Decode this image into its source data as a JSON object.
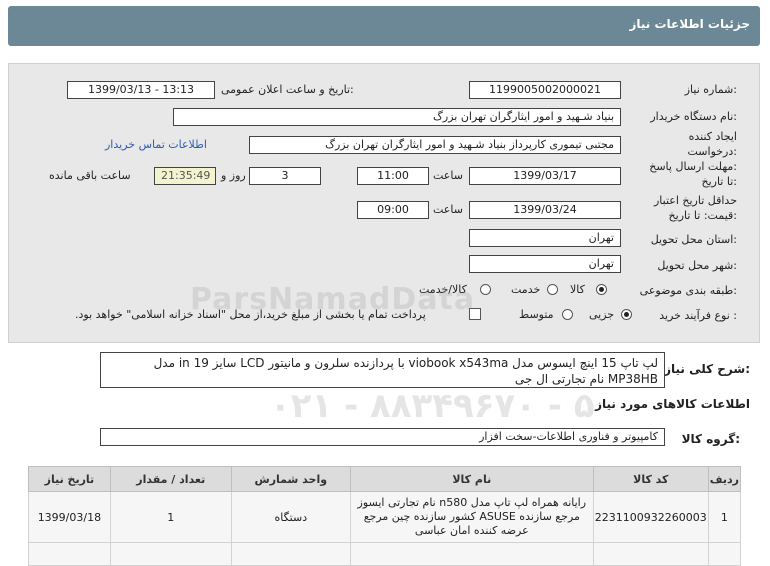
{
  "header": {
    "title": "جزئیات اطلاعات نیاز"
  },
  "fields": {
    "need_number_label": "شماره نیاز:",
    "need_number": "1199005002000021",
    "announce_label": "تاریخ و ساعت اعلان عمومی:",
    "announce_value": "1399/03/13 - 13:13",
    "buyer_label": "نام دستگاه خریدار:",
    "buyer_value": "بنیاد شـهید و امور ایثارگران تهران بزرگ",
    "creator_label_1": "ایجاد کننده",
    "creator_label_2": "درخواست:",
    "creator_value": "مجتبی  تیموری کارپرداز بنیاد شـهید و امور ایثارگران تهران بزرگ",
    "contact_link": "اطلاعات تماس خریدار",
    "deadline_label_1": "مهلت ارسال پاسخ:",
    "deadline_label_2": "تا تاریخ:",
    "deadline_date": "1399/03/17",
    "time_label": "ساعت",
    "deadline_time": "11:00",
    "days_value": "3",
    "days_label": "روز و",
    "remaining_value": "21:35:49",
    "remaining_label": "ساعت باقی مانده",
    "validity_label_1": "حداقل تاریخ اعتبار",
    "validity_label_2": "قیمت: تا تاریخ:",
    "validity_date": "1399/03/24",
    "validity_time_label": "ساعت",
    "validity_time": "09:00",
    "province_label": "استان محل تحویل:",
    "province_value": "تهران",
    "city_label": "شهر محل تحویل:",
    "city_value": "تهران",
    "category_label": "طبقه بندی موضوعی:",
    "category_options": [
      "کالا",
      "خدمت",
      "کالا/خدمت"
    ],
    "process_label": "نوع فرآیند خرید :",
    "process_options": [
      "جزیی",
      "متوسط"
    ],
    "payment_note": "پرداخت تمام یا بخشی از مبلغ خرید،از محل \"اسناد خزانه اسلامی\" خواهد بود."
  },
  "description": {
    "label": "شرح کلی نیاز:",
    "text": "لپ تاپ 15 اینچ ایسوس مدل viobook x543ma با پردازنده سلرون و مانیتور LCD سایز 19 in مدل MP38HB نام تجارتی ال جی"
  },
  "goods": {
    "section_title": "اطلاعات کالاهای مورد نیاز",
    "group_label": "گروه کالا:",
    "group_value": "کامپیوتر و فناوری اطلاعات-سخت افزار"
  },
  "table": {
    "headers": [
      "ردیف",
      "کد کالا",
      "نام کالا",
      "واحد شمارش",
      "تعداد / مقدار",
      "تاریخ نیاز"
    ],
    "rows": [
      {
        "index": "1",
        "code": "2231100932260003",
        "name": "رایانه همراه لپ تاپ مدل n580 نام تجارتی ایسوز مرجع سازنده ASUSE کشور سازنده چین مرجع عرضه کننده امان عباسی",
        "unit": "دستگاه",
        "qty": "1",
        "date": "1399/03/18"
      }
    ]
  },
  "watermark": {
    "line1": "ParsNamadData",
    "line2": "۰۲۱ - ۸۸۳۴۹۶۷۰ - ۵"
  }
}
